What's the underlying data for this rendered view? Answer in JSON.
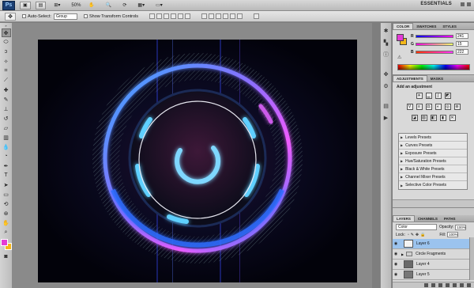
{
  "app": {
    "logo": "Ps",
    "zoom": "50%",
    "workspace": "ESSENTIALS"
  },
  "options": {
    "auto_select_label": "Auto-Select:",
    "auto_select_value": "Group",
    "show_transform_label": "Show Transform Controls"
  },
  "color_panel": {
    "tabs": [
      "COLOR",
      "SWATCHES",
      "STYLES"
    ],
    "channels": [
      {
        "label": "R",
        "value": "241"
      },
      {
        "label": "G",
        "value": "15"
      },
      {
        "label": "B",
        "value": "222"
      }
    ],
    "foreground": "#e43bd6",
    "background": "#f4b71b"
  },
  "adjustments": {
    "tabs": [
      "ADJUSTMENTS",
      "MASKS"
    ],
    "title": "Add an adjustment",
    "presets": [
      "Levels Presets",
      "Curves Presets",
      "Exposure Presets",
      "Hue/Saturation Presets",
      "Black & White Presets",
      "Channel Mixer Presets",
      "Selective Color Presets"
    ]
  },
  "layers": {
    "tabs": [
      "LAYERS",
      "CHANNELS",
      "PATHS"
    ],
    "blend_mode": "Color",
    "opacity_label": "Opacity:",
    "opacity": "100%",
    "lock_label": "Lock:",
    "fill_label": "Fill:",
    "fill": "100%",
    "items": [
      {
        "name": "Layer 6",
        "selected": true
      },
      {
        "name": "Circle Fragments",
        "selected": false,
        "group": true
      },
      {
        "name": "Layer 4",
        "selected": false
      },
      {
        "name": "Layer 5",
        "selected": false
      }
    ]
  },
  "icons": {
    "move": "move-icon",
    "marquee": "marquee-icon",
    "lasso": "lasso-icon",
    "wand": "magic-wand-icon",
    "crop": "crop-icon",
    "eyedropper": "eyedropper-icon",
    "brush": "brush-icon",
    "eraser": "eraser-icon",
    "text": "text-icon",
    "hand": "hand-icon",
    "zoom": "zoom-icon"
  }
}
